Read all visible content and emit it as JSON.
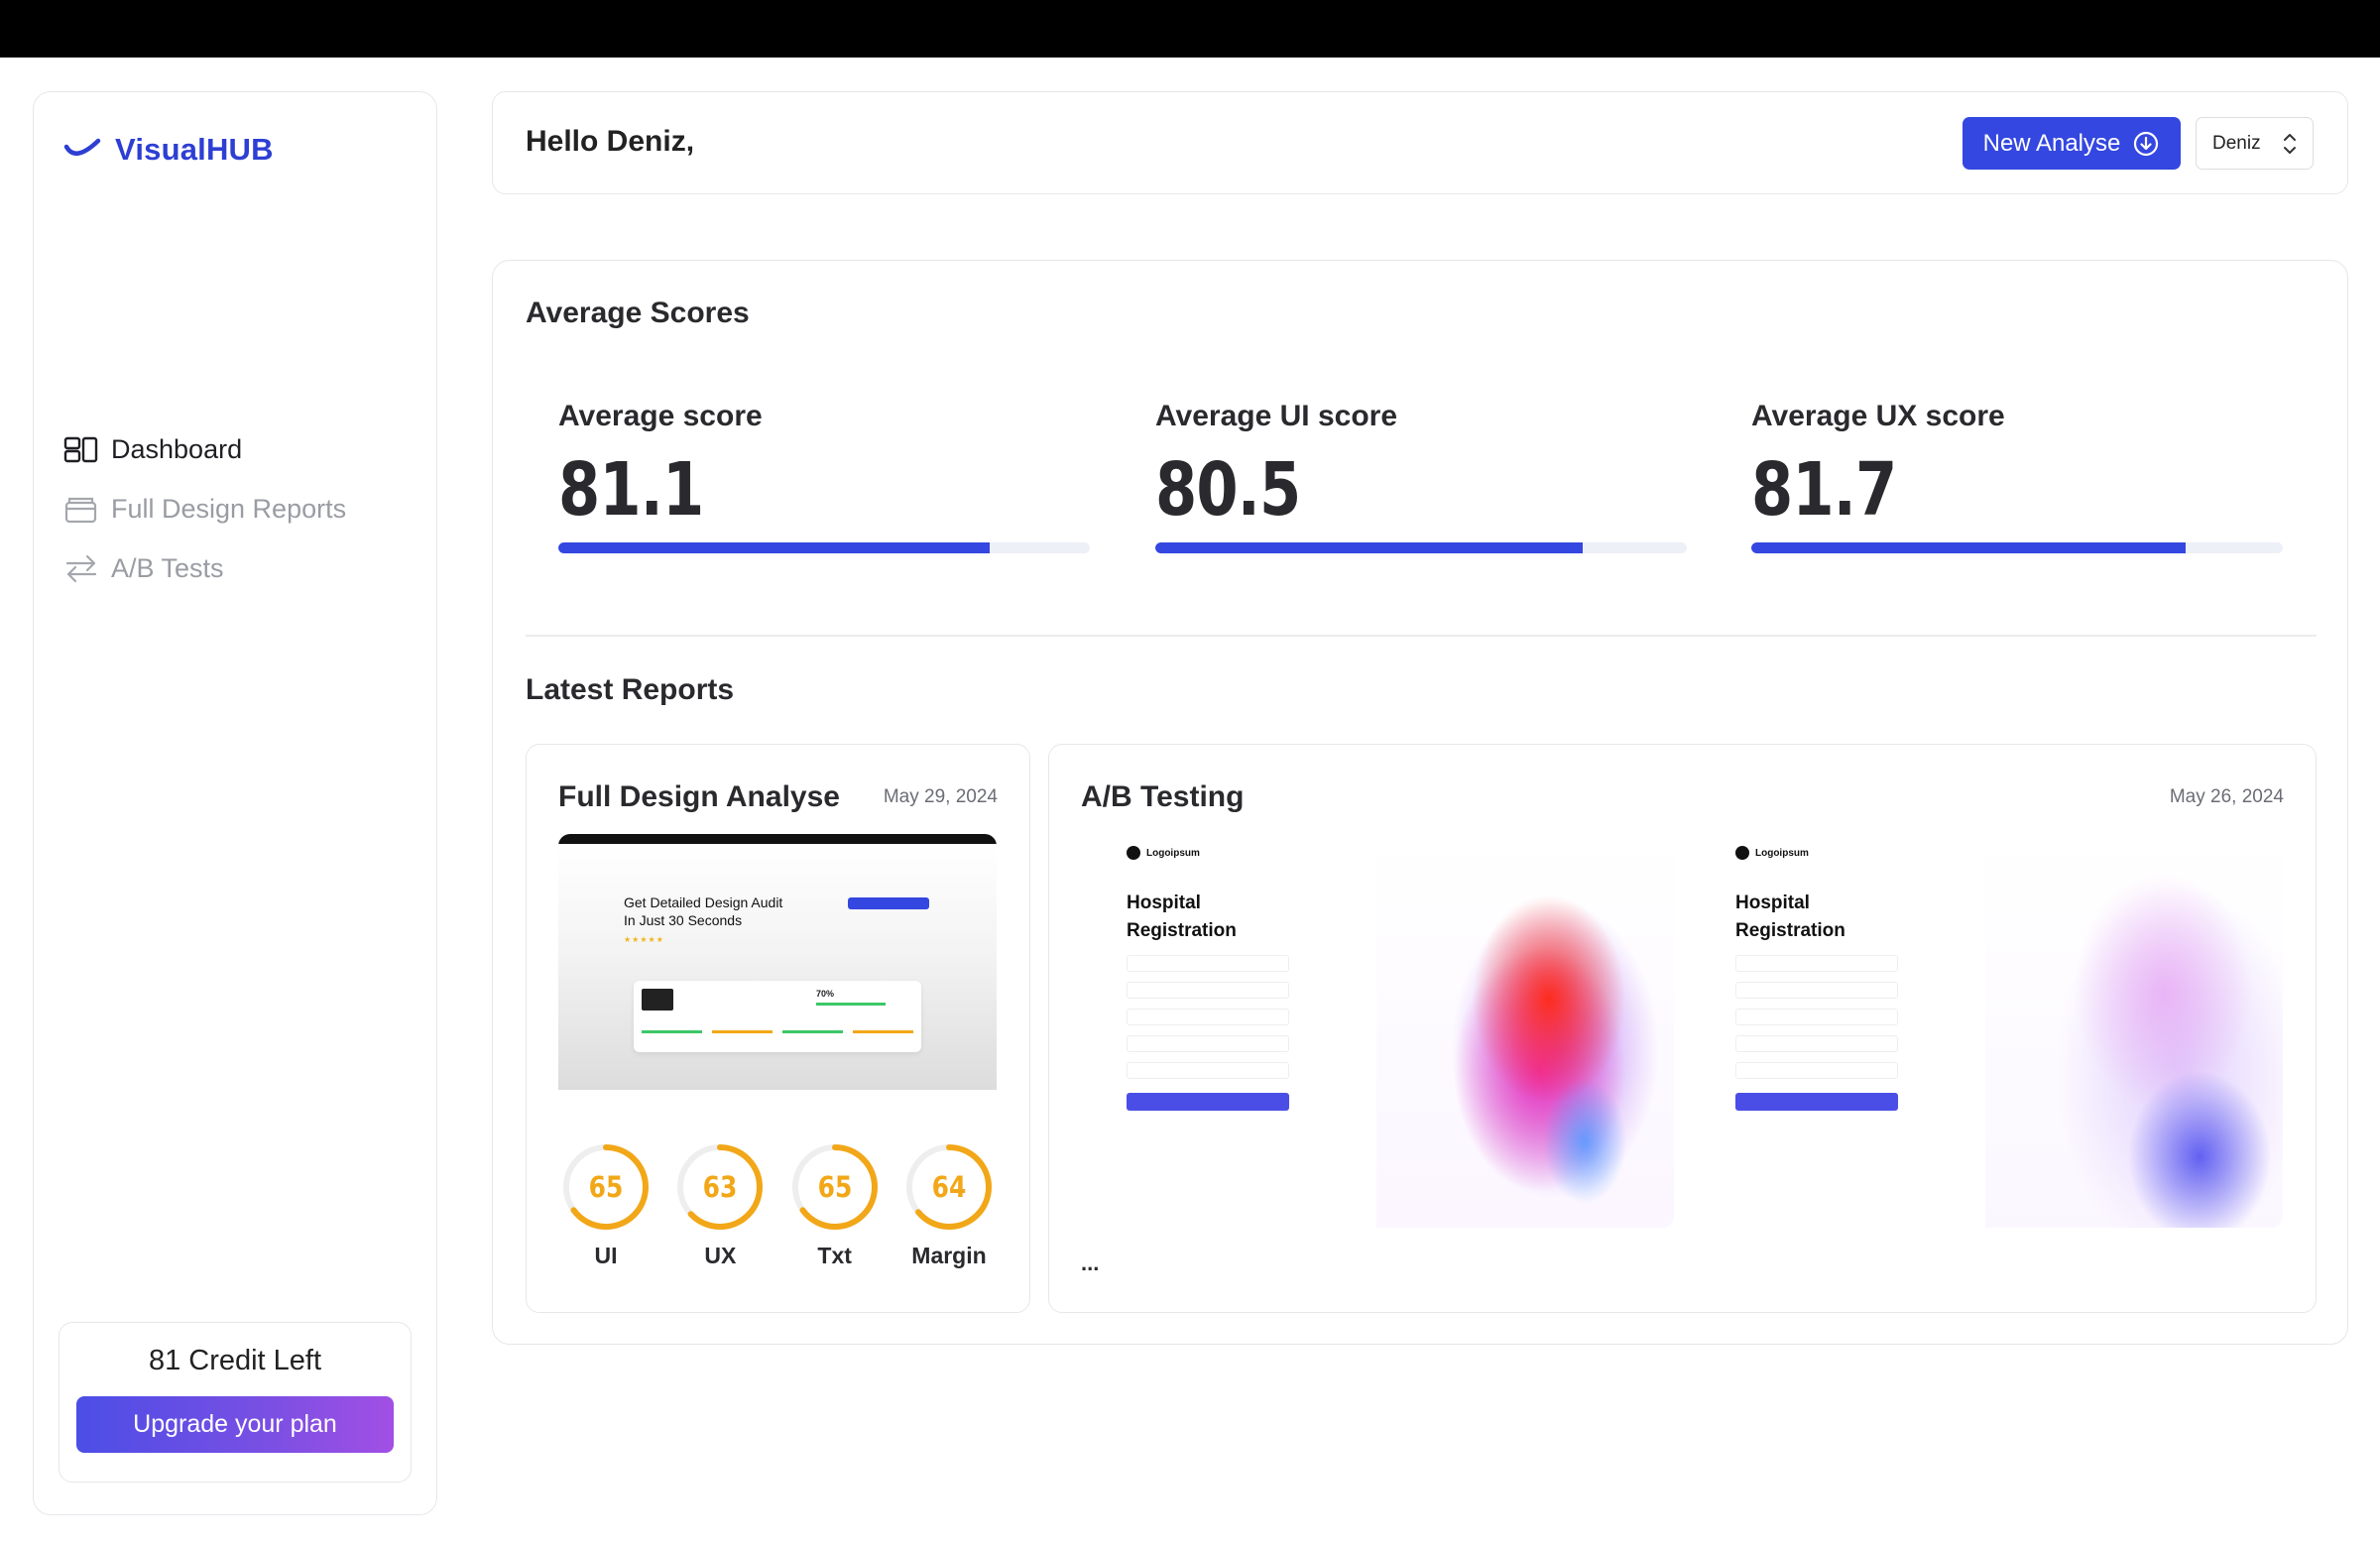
{
  "app": {
    "brand": "VisualHUB"
  },
  "sidebar": {
    "items": [
      {
        "label": "Dashboard",
        "icon": "dashboard-icon",
        "active": true
      },
      {
        "label": "Full Design Reports",
        "icon": "archive-icon",
        "active": false
      },
      {
        "label": "A/B Tests",
        "icon": "swap-arrows-icon",
        "active": false
      }
    ],
    "credit": {
      "text": "81 Credit Left",
      "upgrade_label": "Upgrade your plan"
    }
  },
  "header": {
    "greeting": "Hello Deniz,",
    "new_button_label": "New Analyse",
    "user_select_value": "Deniz"
  },
  "scores": {
    "title": "Average Scores",
    "items": [
      {
        "label": "Average score",
        "value": "81.1",
        "progress": 0.811
      },
      {
        "label": "Average UI score",
        "value": "80.5",
        "progress": 0.805
      },
      {
        "label": "Average UX score",
        "value": "81.7",
        "progress": 0.817
      }
    ]
  },
  "reports": {
    "title": "Latest Reports",
    "design_card": {
      "title": "Full Design Analyse",
      "date": "May 29, 2024",
      "preview": {
        "headline_line1": "Get Detailed Design Audit",
        "headline_line2": "In Just 30 Seconds",
        "overall": "70%"
      },
      "rings": [
        {
          "value": "65",
          "label": "UI",
          "progress": 0.65
        },
        {
          "value": "63",
          "label": "UX",
          "progress": 0.63
        },
        {
          "value": "65",
          "label": "Txt",
          "progress": 0.65
        },
        {
          "value": "64",
          "label": "Margin",
          "progress": 0.64
        }
      ]
    },
    "ab_card": {
      "title": "A/B Testing",
      "date": "May 26, 2024",
      "more": "...",
      "variants": [
        {
          "logo": "Logoipsum",
          "heading_line1": "Hospital",
          "heading_line2": "Registration"
        },
        {
          "logo": "Logoipsum",
          "heading_line1": "Hospital",
          "heading_line2": "Registration"
        }
      ]
    }
  },
  "colors": {
    "accent": "#3447e0",
    "ring": "#f2a718",
    "brand": "#2d3fd3"
  }
}
